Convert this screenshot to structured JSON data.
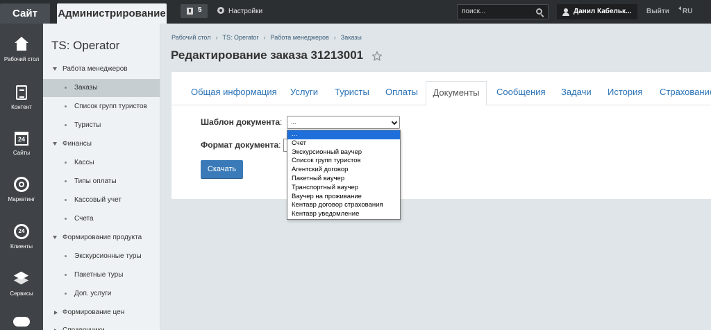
{
  "topbar": {
    "site_tab": "Сайт",
    "admin_tab": "Администрирование",
    "notifications_count": "5",
    "settings_label": "Настройки",
    "search_placeholder": "поиск...",
    "user_name": "Данил Кабельк...",
    "logout_label": "Выйти",
    "lang_label": "RU"
  },
  "iconbar": {
    "items": [
      {
        "label": "Рабочий стол",
        "icon": "home-icon"
      },
      {
        "label": "Контент",
        "icon": "document-icon"
      },
      {
        "label": "Сайты",
        "icon": "calendar-icon",
        "glyph": "24"
      },
      {
        "label": "Маркетинг",
        "icon": "target-icon"
      },
      {
        "label": "Клиенты",
        "icon": "clock-icon",
        "glyph": "24"
      },
      {
        "label": "Сервисы",
        "icon": "layers-icon"
      },
      {
        "label": "",
        "icon": "cloud-icon"
      }
    ]
  },
  "sidebar": {
    "title": "TS: Operator",
    "rows": [
      {
        "type": "group",
        "label": "Работа менеджеров",
        "expanded": true
      },
      {
        "type": "item",
        "label": "Заказы",
        "active": true
      },
      {
        "type": "item",
        "label": "Список групп туристов"
      },
      {
        "type": "item",
        "label": "Туристы"
      },
      {
        "type": "group",
        "label": "Финансы",
        "expanded": true
      },
      {
        "type": "item",
        "label": "Кассы"
      },
      {
        "type": "item",
        "label": "Типы оплаты"
      },
      {
        "type": "item",
        "label": "Кассовый учет"
      },
      {
        "type": "item",
        "label": "Счета"
      },
      {
        "type": "group",
        "label": "Формирование продукта",
        "expanded": true
      },
      {
        "type": "item",
        "label": "Экскурсионные туры"
      },
      {
        "type": "item",
        "label": "Пакетные туры"
      },
      {
        "type": "item",
        "label": "Доп. услуги"
      },
      {
        "type": "group",
        "label": "Формирование цен",
        "expanded": false
      },
      {
        "type": "group",
        "label": "Справочники",
        "expanded": false
      }
    ]
  },
  "main": {
    "breadcrumb": [
      "Рабочий стол",
      "TS: Operator",
      "Работа менеджеров",
      "Заказы"
    ],
    "breadcrumb_separator": "›",
    "title": "Редактирование заказа 31213001",
    "tabs": [
      {
        "label": "Общая информация"
      },
      {
        "label": "Услуги"
      },
      {
        "label": "Туристы"
      },
      {
        "label": "Оплаты"
      },
      {
        "label": "Документы",
        "active": true
      },
      {
        "label": "Сообщения"
      },
      {
        "label": "Задачи"
      },
      {
        "label": "История"
      },
      {
        "label": "Страхование"
      }
    ],
    "form": {
      "template_label": "Шаблон документа",
      "format_label": "Формат документа",
      "colon": ":",
      "template_value": "...",
      "template_options": [
        "...",
        "Счет",
        "Экскурсионный ваучер",
        "Список групп туристов",
        "Агентский договор",
        "Пакетный ваучер",
        "Транспортный ваучер",
        "Ваучер на проживание",
        "Кентавр договор страхования",
        "Кентавр уведомление"
      ],
      "selected_option_index": 0,
      "download_button": "Скачать"
    }
  },
  "colors": {
    "topbar_bg": "#2c2f32",
    "iconbar_bg": "#3f4347",
    "sidebar_bg": "#eef2f4",
    "accent_link": "#2a72b5",
    "button_bg": "#3a7ab8",
    "option_highlight": "#1e6fd9"
  }
}
